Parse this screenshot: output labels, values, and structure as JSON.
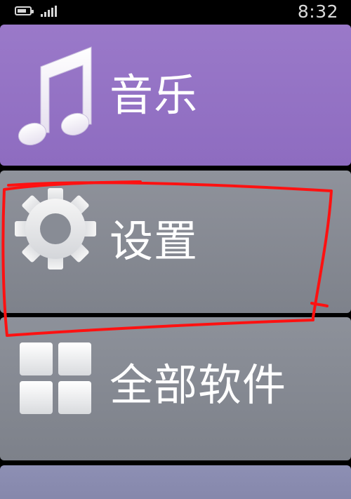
{
  "status_bar": {
    "time": "8:32",
    "battery_level": 0.75
  },
  "tiles": [
    {
      "label": "音乐",
      "icon": "music-note-icon",
      "color": "#9475c6"
    },
    {
      "label": "设置",
      "icon": "gear-icon",
      "color": "#888c95"
    },
    {
      "label": "全部软件",
      "icon": "app-grid-icon",
      "color": "#878b94"
    }
  ],
  "annotation": {
    "color": "#ff0000",
    "target": "设置"
  }
}
